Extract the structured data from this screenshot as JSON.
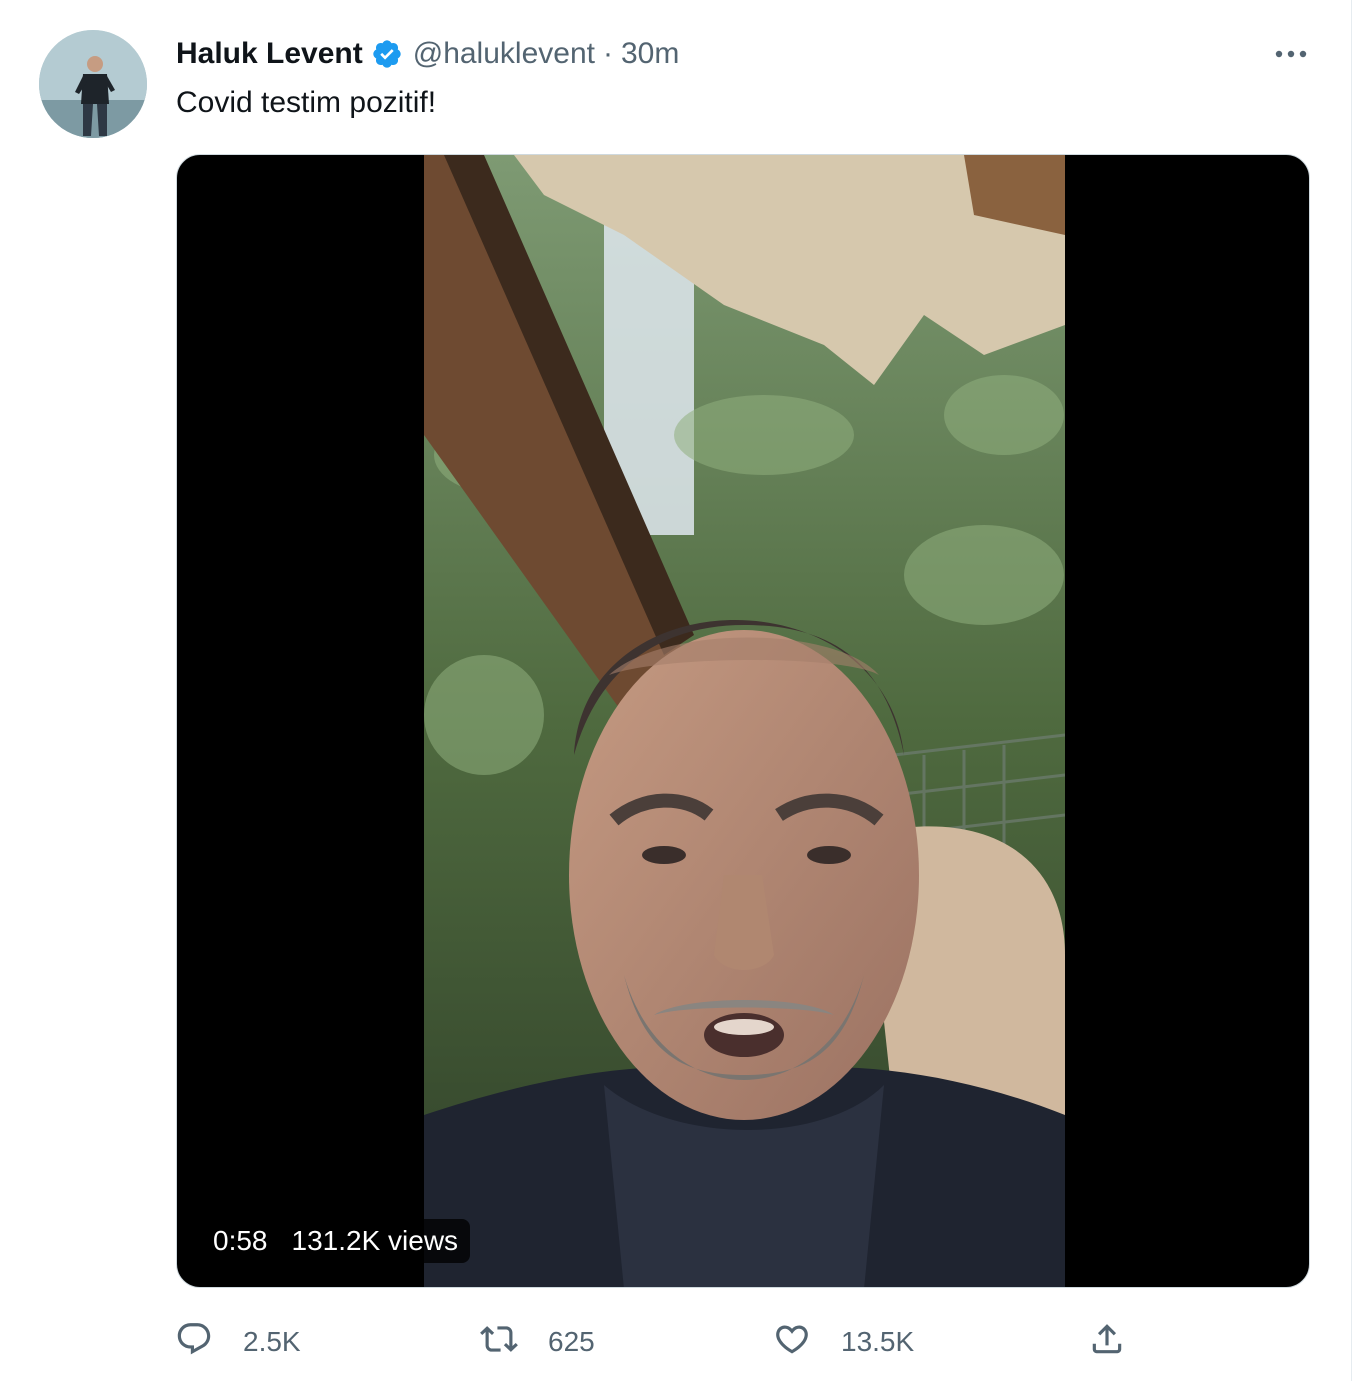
{
  "author": {
    "display_name": "Haluk Levent",
    "handle": "@haluklevent",
    "separator": "·",
    "time": "30m",
    "verified": true
  },
  "tweet": {
    "text": "Covid testim pozitif!"
  },
  "video": {
    "duration": "0:58",
    "views": "131.2K views"
  },
  "actions": {
    "reply_count": "2.5K",
    "retweet_count": "625",
    "like_count": "13.5K"
  },
  "icons": {
    "verified": "verified-badge-icon",
    "more": "more-horizontal-icon",
    "reply": "reply-icon",
    "retweet": "retweet-icon",
    "like": "heart-icon",
    "share": "share-icon"
  },
  "colors": {
    "text_primary": "#0f1419",
    "text_secondary": "#536471",
    "verified_blue": "#1d9bf0"
  }
}
